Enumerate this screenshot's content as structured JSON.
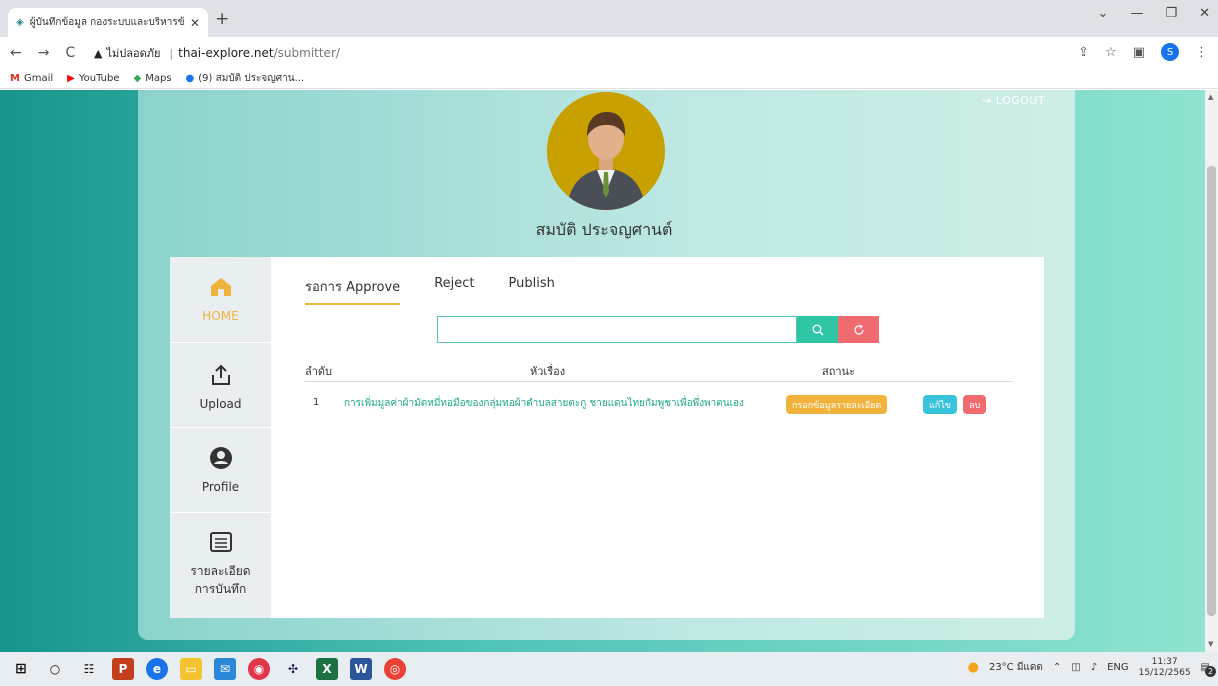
{
  "browser": {
    "tab_title": "ผู้บันทึกข้อมูล กองระบบและบริหารข้อมู",
    "url_warning": "ไม่ปลอดภัย",
    "url_domain": "thai-explore.net",
    "url_path": "/submitter/",
    "profile_initial": "S",
    "bookmarks": [
      {
        "label": "Gmail",
        "icon": "gmail-icon"
      },
      {
        "label": "YouTube",
        "icon": "youtube-icon"
      },
      {
        "label": "Maps",
        "icon": "maps-icon"
      },
      {
        "label": "(9) สมบัติ ประจญศาน...",
        "icon": "facebook-icon"
      }
    ]
  },
  "header": {
    "logout_label": "LOGOUT",
    "user_name": "สมบัติ ประจญศานต์"
  },
  "sidebar": {
    "items": [
      {
        "label": "HOME",
        "icon": "home-icon"
      },
      {
        "label": "Upload",
        "icon": "upload-icon"
      },
      {
        "label": "Profile",
        "icon": "profile-icon"
      },
      {
        "label": "รายละเอียด การบันทึก",
        "icon": "details-icon"
      }
    ]
  },
  "tabs": [
    {
      "label": "รอการ Approve",
      "active": true
    },
    {
      "label": "Reject",
      "active": false
    },
    {
      "label": "Publish",
      "active": false
    }
  ],
  "search": {
    "value": "",
    "placeholder": ""
  },
  "table": {
    "columns": [
      "ลำดับ",
      "หัวเรื่อง",
      "สถานะ"
    ],
    "rows": [
      {
        "index": "1",
        "title": "การเพิ่มมูลค่าผ้ามัดหมี่ทอมือของกลุ่มทอผ้าตำบลสายตะกู ชายแดนไทยกัมพูชาเพื่อพึ่งพาตนเอง",
        "status": "กรอกข้อมูลรายละเอียด",
        "edit_label": "แก้ไข",
        "delete_label": "ลบ"
      }
    ]
  },
  "taskbar": {
    "weather": "23°C มีแดด",
    "lang": "ENG",
    "time": "11:37",
    "date": "15/12/2565",
    "notifications": "2"
  },
  "colors": {
    "accent_yellow": "#f2b33d",
    "teal": "#2fc6a3",
    "red": "#ef6b70",
    "edit_blue": "#37c3d9",
    "link_green": "#1ea889"
  }
}
